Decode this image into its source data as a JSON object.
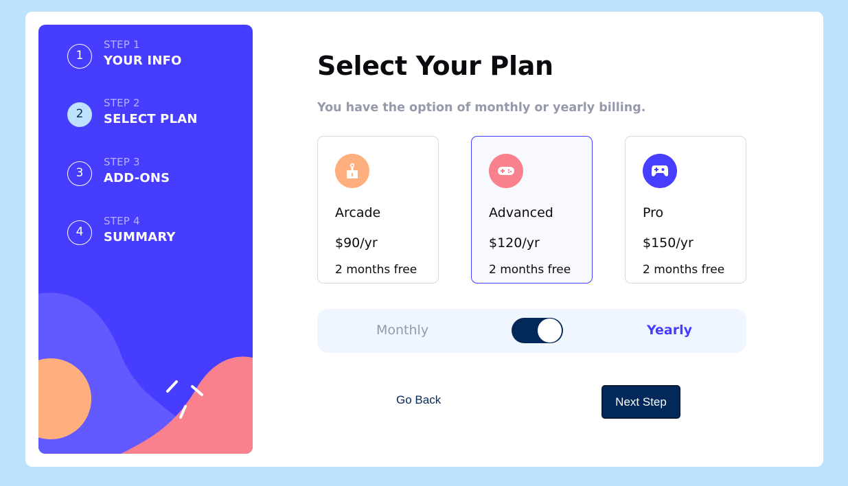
{
  "sidebar": {
    "steps": [
      {
        "number": "1",
        "small": "STEP 1",
        "label": "YOUR INFO"
      },
      {
        "number": "2",
        "small": "STEP 2",
        "label": "SELECT PLAN"
      },
      {
        "number": "3",
        "small": "STEP 3",
        "label": "ADD-ONS"
      },
      {
        "number": "4",
        "small": "STEP 4",
        "label": "SUMMARY"
      }
    ],
    "active_step": "2"
  },
  "main": {
    "title": "Select Your Plan",
    "subtitle": "You have the option of monthly or yearly billing.",
    "plans": [
      {
        "name": "Arcade",
        "price": "$90/yr",
        "promo": "2 months free",
        "icon": "arcade-icon",
        "color": "#ffaf7e"
      },
      {
        "name": "Advanced",
        "price": "$120/yr",
        "promo": "2 months free",
        "icon": "gamepad-icon",
        "color": "#f9818e"
      },
      {
        "name": "Pro",
        "price": "$150/yr",
        "promo": "2 months free",
        "icon": "controller-icon",
        "color": "#483eff"
      }
    ],
    "selected_plan": "Advanced",
    "billing": {
      "monthly_label": "Monthly",
      "yearly_label": "Yearly",
      "selected": "Yearly"
    }
  },
  "footer": {
    "back_label": "Go Back",
    "next_label": "Next Step"
  },
  "colors": {
    "page_bg": "#bde2fb",
    "sidebar_bg": "#473dff",
    "accent": "#473dff",
    "primary_dark": "#02295a",
    "muted": "#9699ab"
  }
}
